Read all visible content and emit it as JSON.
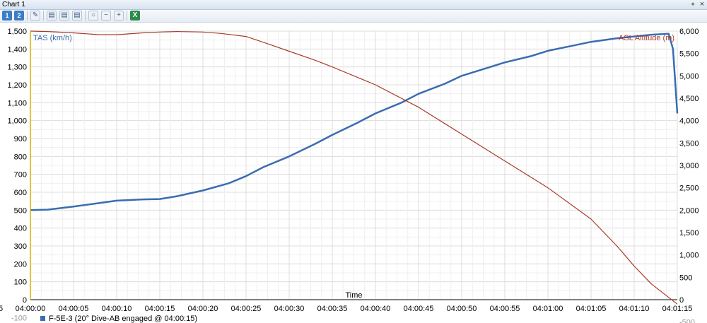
{
  "window": {
    "title": "Chart 1"
  },
  "toolbar": {
    "buttons": [
      {
        "name": "chart-1-button",
        "label": "1"
      },
      {
        "name": "chart-2-button",
        "label": "2"
      },
      {
        "name": "wrench-icon"
      },
      {
        "name": "chart-settings-1-icon"
      },
      {
        "name": "chart-settings-2-icon"
      },
      {
        "name": "chart-settings-3-icon"
      },
      {
        "name": "zoom-icon"
      },
      {
        "name": "zoom-out-icon"
      },
      {
        "name": "zoom-in-icon"
      },
      {
        "name": "excel-export-icon"
      }
    ]
  },
  "chart_data": {
    "type": "line",
    "xlabel": "Time",
    "x_ticks": [
      "04:00:00",
      "04:00:05",
      "04:00:10",
      "04:00:15",
      "04:00:20",
      "04:00:25",
      "04:00:30",
      "04:00:35",
      "04:00:40",
      "04:00:45",
      "04:00:50",
      "04:00:55",
      "04:01:00",
      "04:01:05",
      "04:01:10",
      "04:01:15"
    ],
    "x_tick_left_partial": "5",
    "xlim_seconds": [
      0,
      75
    ],
    "y_left": {
      "label": "TAS (km/h)",
      "ylim": [
        -100,
        1500
      ],
      "ticks": [
        "-100",
        "0",
        "100",
        "200",
        "300",
        "400",
        "500",
        "600",
        "700",
        "800",
        "900",
        "1,000",
        "1,100",
        "1,200",
        "1,300",
        "1,400",
        "1,500"
      ],
      "color": "#3a6db0"
    },
    "y_right": {
      "label": "ASL Altitude (m)",
      "ylim": [
        -500,
        6000
      ],
      "ticks": [
        "-500",
        "0",
        "500",
        "1,000",
        "1,500",
        "2,000",
        "2,500",
        "3,000",
        "3,500",
        "4,000",
        "4,500",
        "5,000",
        "5,500",
        "6,000"
      ],
      "color": "#a83a2a"
    },
    "series": [
      {
        "axis": "left",
        "color": "#3a6db0",
        "x": [
          0,
          2,
          5,
          8,
          10,
          13,
          15,
          17,
          20,
          23,
          25,
          27,
          30,
          33,
          35,
          38,
          40,
          43,
          45,
          48,
          50,
          53,
          55,
          58,
          60,
          63,
          65,
          68,
          70,
          72,
          74,
          74.5,
          75
        ],
        "y": [
          500,
          503,
          520,
          540,
          553,
          560,
          562,
          578,
          610,
          650,
          690,
          740,
          800,
          870,
          920,
          990,
          1040,
          1100,
          1150,
          1205,
          1250,
          1295,
          1325,
          1360,
          1390,
          1420,
          1440,
          1460,
          1470,
          1480,
          1485,
          1400,
          1040
        ]
      },
      {
        "axis": "right",
        "color": "#a83a2a",
        "x": [
          0,
          2,
          5,
          8,
          10,
          13,
          15,
          17,
          20,
          22,
          25,
          27,
          30,
          33,
          35,
          40,
          45,
          50,
          55,
          60,
          65,
          68,
          70,
          72,
          74,
          75
        ],
        "y": [
          6000,
          5990,
          5960,
          5920,
          5920,
          5960,
          5980,
          5990,
          5980,
          5950,
          5880,
          5750,
          5550,
          5350,
          5200,
          4800,
          4300,
          3700,
          3100,
          2500,
          1800,
          1200,
          750,
          350,
          50,
          -100
        ]
      }
    ],
    "cursor_x": 0,
    "legend": {
      "placement": "bottom-left",
      "entries": [
        {
          "label": "F-5E-3 (20° Dive-AB engaged @ 04:00:15)",
          "color": "#3a6db0"
        }
      ]
    },
    "grid": true
  }
}
